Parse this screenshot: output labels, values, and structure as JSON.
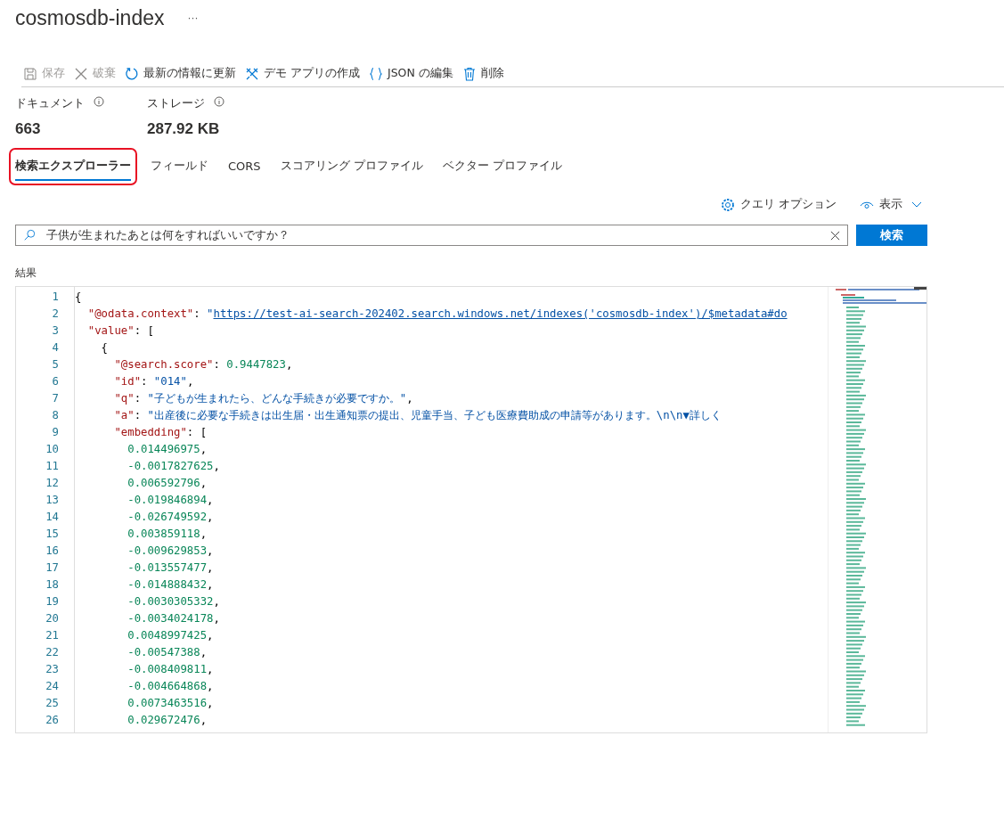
{
  "header": {
    "title": "cosmosdb-index",
    "more": "···"
  },
  "toolbar": [
    {
      "kind": "save",
      "label": "保存",
      "disabled": true
    },
    {
      "kind": "discard",
      "label": "破棄",
      "disabled": true
    },
    {
      "kind": "refresh",
      "label": "最新の情報に更新",
      "disabled": false
    },
    {
      "kind": "demo",
      "label": "デモ アプリの作成",
      "disabled": false
    },
    {
      "kind": "json",
      "label": "JSON の編集",
      "disabled": false
    },
    {
      "kind": "delete",
      "label": "削除",
      "disabled": false
    }
  ],
  "stats": [
    {
      "label": "ドキュメント",
      "value": "663"
    },
    {
      "label": "ストレージ",
      "value": "287.92 KB"
    }
  ],
  "tabs": [
    {
      "label": "検索エクスプローラー",
      "selected": true,
      "highlighted": true
    },
    {
      "label": "フィールド",
      "selected": false,
      "highlighted": false
    },
    {
      "label": "CORS",
      "selected": false,
      "highlighted": false
    },
    {
      "label": "スコアリング プロファイル",
      "selected": false,
      "highlighted": false
    },
    {
      "label": "ベクター プロファイル",
      "selected": false,
      "highlighted": false
    }
  ],
  "options": {
    "query_options": "クエリ オプション",
    "view": "表示"
  },
  "search": {
    "value": "子供が生まれたあとは何をすればいいですか？",
    "button": "検索"
  },
  "results_label": "結果",
  "editor": {
    "lines": [
      {
        "number": "1",
        "tokens": [
          {
            "kind": "punct",
            "text": "{"
          }
        ]
      },
      {
        "number": "2",
        "tokens": [
          {
            "kind": "key",
            "text": "  \"@odata.context\""
          },
          {
            "kind": "punct",
            "text": ": "
          },
          {
            "kind": "string",
            "text": "\""
          },
          {
            "kind": "link",
            "text": "https://test-ai-search-202402.search.windows.net/indexes('cosmosdb-index')/$metadata#do"
          }
        ]
      },
      {
        "number": "3",
        "tokens": [
          {
            "kind": "key",
            "text": "  \"value\""
          },
          {
            "kind": "punct",
            "text": ": ["
          }
        ]
      },
      {
        "number": "4",
        "tokens": [
          {
            "kind": "punct",
            "text": "    {"
          }
        ]
      },
      {
        "number": "5",
        "tokens": [
          {
            "kind": "key",
            "text": "      \"@search.score\""
          },
          {
            "kind": "punct",
            "text": ": "
          },
          {
            "kind": "number",
            "text": "0.9447823"
          },
          {
            "kind": "punct",
            "text": ","
          }
        ]
      },
      {
        "number": "6",
        "tokens": [
          {
            "kind": "key",
            "text": "      \"id\""
          },
          {
            "kind": "punct",
            "text": ": "
          },
          {
            "kind": "string",
            "text": "\"014\""
          },
          {
            "kind": "punct",
            "text": ","
          }
        ]
      },
      {
        "number": "7",
        "tokens": [
          {
            "kind": "key",
            "text": "      \"q\""
          },
          {
            "kind": "punct",
            "text": ": "
          },
          {
            "kind": "string",
            "text": "\"子どもが生まれたら、どんな手続きが必要ですか。\""
          },
          {
            "kind": "punct",
            "text": ","
          }
        ]
      },
      {
        "number": "8",
        "tokens": [
          {
            "kind": "key",
            "text": "      \"a\""
          },
          {
            "kind": "punct",
            "text": ": "
          },
          {
            "kind": "string",
            "text": "\"出産後に必要な手続きは出生届・出生通知票の提出、児童手当、子ども医療費助成の申請等があります。\\n\\n▼詳しく"
          }
        ]
      },
      {
        "number": "9",
        "tokens": [
          {
            "kind": "key",
            "text": "      \"embedding\""
          },
          {
            "kind": "punct",
            "text": ": ["
          }
        ]
      },
      {
        "number": "10",
        "tokens": [
          {
            "kind": "number",
            "text": "        0.014496975"
          },
          {
            "kind": "punct",
            "text": ","
          }
        ]
      },
      {
        "number": "11",
        "tokens": [
          {
            "kind": "number",
            "text": "        -0.0017827625"
          },
          {
            "kind": "punct",
            "text": ","
          }
        ]
      },
      {
        "number": "12",
        "tokens": [
          {
            "kind": "number",
            "text": "        0.006592796"
          },
          {
            "kind": "punct",
            "text": ","
          }
        ]
      },
      {
        "number": "13",
        "tokens": [
          {
            "kind": "number",
            "text": "        -0.019846894"
          },
          {
            "kind": "punct",
            "text": ","
          }
        ]
      },
      {
        "number": "14",
        "tokens": [
          {
            "kind": "number",
            "text": "        -0.026749592"
          },
          {
            "kind": "punct",
            "text": ","
          }
        ]
      },
      {
        "number": "15",
        "tokens": [
          {
            "kind": "number",
            "text": "        0.003859118"
          },
          {
            "kind": "punct",
            "text": ","
          }
        ]
      },
      {
        "number": "16",
        "tokens": [
          {
            "kind": "number",
            "text": "        -0.009629853"
          },
          {
            "kind": "punct",
            "text": ","
          }
        ]
      },
      {
        "number": "17",
        "tokens": [
          {
            "kind": "number",
            "text": "        -0.013557477"
          },
          {
            "kind": "punct",
            "text": ","
          }
        ]
      },
      {
        "number": "18",
        "tokens": [
          {
            "kind": "number",
            "text": "        -0.014888432"
          },
          {
            "kind": "punct",
            "text": ","
          }
        ]
      },
      {
        "number": "19",
        "tokens": [
          {
            "kind": "number",
            "text": "        -0.0030305332"
          },
          {
            "kind": "punct",
            "text": ","
          }
        ]
      },
      {
        "number": "20",
        "tokens": [
          {
            "kind": "number",
            "text": "        -0.0034024178"
          },
          {
            "kind": "punct",
            "text": ","
          }
        ]
      },
      {
        "number": "21",
        "tokens": [
          {
            "kind": "number",
            "text": "        0.0048997425"
          },
          {
            "kind": "punct",
            "text": ","
          }
        ]
      },
      {
        "number": "22",
        "tokens": [
          {
            "kind": "number",
            "text": "        -0.00547388"
          },
          {
            "kind": "punct",
            "text": ","
          }
        ]
      },
      {
        "number": "23",
        "tokens": [
          {
            "kind": "number",
            "text": "        -0.008409811"
          },
          {
            "kind": "punct",
            "text": ","
          }
        ]
      },
      {
        "number": "24",
        "tokens": [
          {
            "kind": "number",
            "text": "        -0.004664868"
          },
          {
            "kind": "punct",
            "text": ","
          }
        ]
      },
      {
        "number": "25",
        "tokens": [
          {
            "kind": "number",
            "text": "        0.0073463516"
          },
          {
            "kind": "punct",
            "text": ","
          }
        ]
      },
      {
        "number": "26",
        "tokens": [
          {
            "kind": "number",
            "text": "        0.029672476"
          },
          {
            "kind": "punct",
            "text": ","
          }
        ]
      }
    ]
  }
}
